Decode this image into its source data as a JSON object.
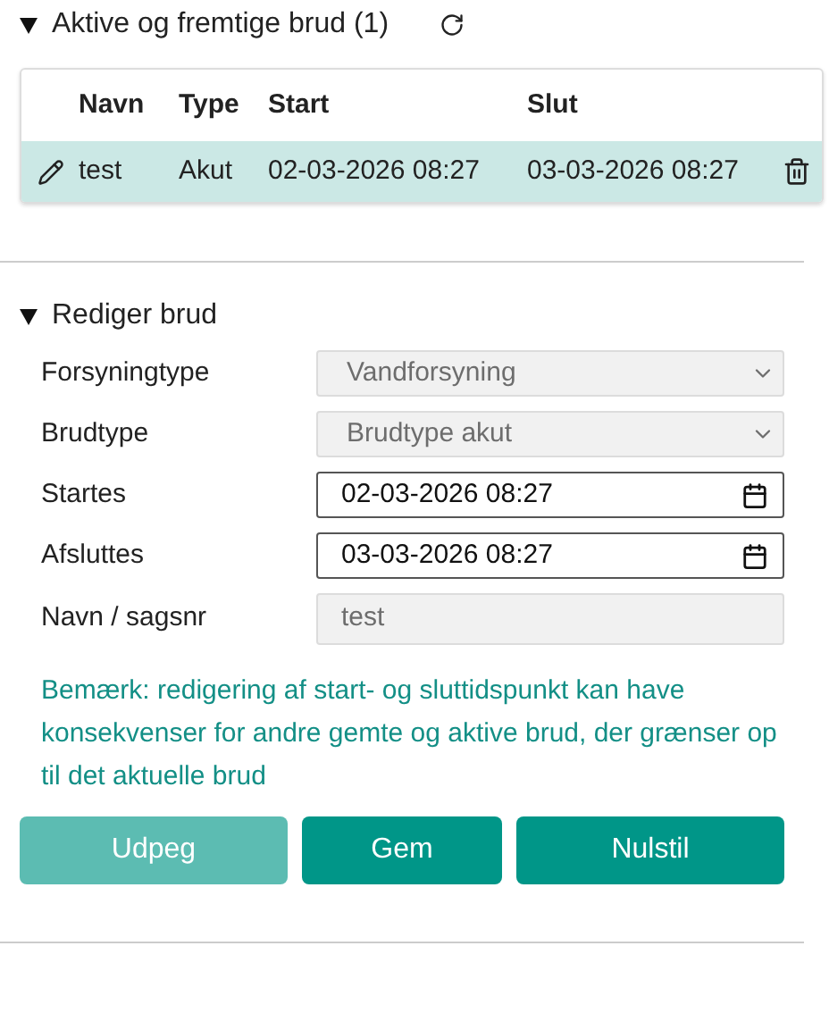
{
  "list_section": {
    "title": "Aktive og fremtige brud (1)",
    "expanded": true,
    "table": {
      "columns": [
        "Navn",
        "Type",
        "Start",
        "Slut"
      ],
      "rows": [
        {
          "cells": [
            "test",
            "Akut",
            "02-03-2026 08:27",
            "03-03-2026 08:27"
          ],
          "selected": true
        }
      ]
    }
  },
  "edit_section": {
    "title": "Rediger brud",
    "expanded": true,
    "fields": [
      {
        "label": "Forsyningtype",
        "kind": "select",
        "value": "Vandforsyning",
        "disabled": true
      },
      {
        "label": "Brudtype",
        "kind": "select",
        "value": "Brudtype akut",
        "disabled": true
      },
      {
        "label": "Startes",
        "kind": "datetime",
        "value": "02-03-2026 08:27",
        "disabled": false
      },
      {
        "label": "Afsluttes",
        "kind": "datetime",
        "value": "03-03-2026 08:27",
        "disabled": false
      },
      {
        "label": "Navn / sagsnr",
        "kind": "text",
        "value": "test",
        "disabled": true
      }
    ],
    "note": "Bemærk: redigering af start- og sluttidspunkt kan have konsekvenser for andre gemte og aktive brud, der grænser op til det aktuelle brud",
    "buttons": [
      {
        "label": "Udpeg",
        "disabled": true
      },
      {
        "label": "Gem",
        "disabled": false
      },
      {
        "label": "Nulstil",
        "disabled": false
      }
    ]
  }
}
